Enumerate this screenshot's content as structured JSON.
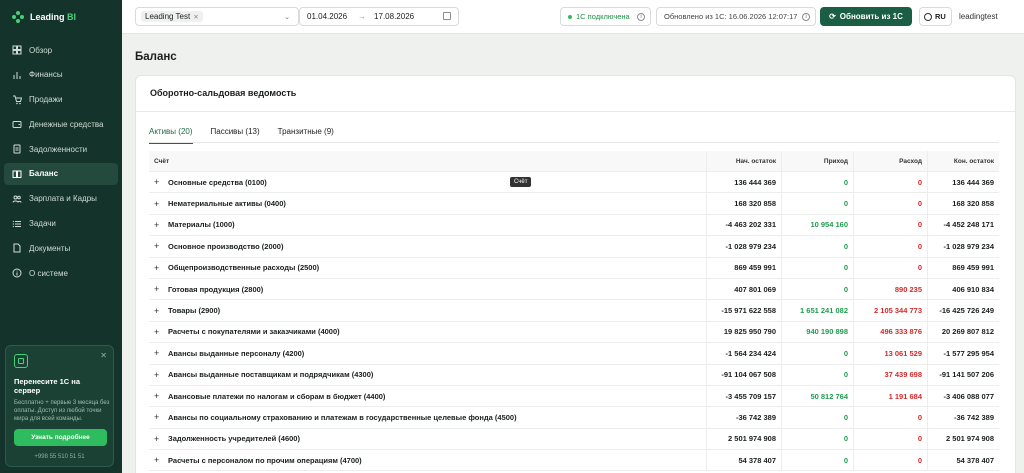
{
  "brand": {
    "name_part1": "Leading",
    "name_part2": "BI"
  },
  "sidebar": {
    "items": [
      {
        "label": "Обзор",
        "icon": "grid-icon",
        "active": false
      },
      {
        "label": "Финансы",
        "icon": "bar-chart-icon",
        "active": false
      },
      {
        "label": "Продажи",
        "icon": "cart-icon",
        "active": false
      },
      {
        "label": "Денежные средства",
        "icon": "wallet-icon",
        "active": false
      },
      {
        "label": "Задолженности",
        "icon": "document-icon",
        "active": false
      },
      {
        "label": "Баланс",
        "icon": "book-icon",
        "active": true
      },
      {
        "label": "Зарплата и Кадры",
        "icon": "users-icon",
        "active": false
      },
      {
        "label": "Задачи",
        "icon": "list-icon",
        "active": false
      },
      {
        "label": "Документы",
        "icon": "file-icon",
        "active": false
      },
      {
        "label": "О системе",
        "icon": "info-icon",
        "active": false
      }
    ],
    "promo": {
      "title": "Перенесите 1С на сервер",
      "text": "Бесплатно + первые 3 месяца без оплаты. Доступ из любой точки мира для всей команды.",
      "button": "Узнать подробнее",
      "phone": "+998 55 510 51 51"
    }
  },
  "topbar": {
    "company": "Leading Test",
    "date_from": "01.04.2026",
    "date_to": "17.08.2026",
    "connection_status": "1С подключена",
    "updated_text": "Обновлено из 1С: 16.06.2026 12:07:17",
    "refresh_button": "Обновить из 1С",
    "language": "RU",
    "user": "leadingtest"
  },
  "page": {
    "title": "Баланс",
    "card_title": "Оборотно-сальдовая ведомость",
    "tabs": [
      {
        "label": "Активы (20)",
        "active": true
      },
      {
        "label": "Пассивы (13)",
        "active": false
      },
      {
        "label": "Транзитные (9)",
        "active": false
      }
    ],
    "tooltip": "Счёт"
  },
  "table": {
    "columns": [
      "Счёт",
      "Нач. остаток",
      "Приход",
      "Расход",
      "Кон. остаток"
    ],
    "rows": [
      {
        "name": "Основные средства (0100)",
        "start": "136 444 369",
        "income": "0",
        "expense": "0",
        "end": "136 444 369"
      },
      {
        "name": "Нематериальные активы (0400)",
        "start": "168 320 858",
        "income": "0",
        "expense": "0",
        "end": "168 320 858"
      },
      {
        "name": "Материалы (1000)",
        "start": "-4 463 202 331",
        "income": "10 954 160",
        "expense": "0",
        "end": "-4 452 248 171"
      },
      {
        "name": "Основное производство (2000)",
        "start": "-1 028 979 234",
        "income": "0",
        "expense": "0",
        "end": "-1 028 979 234"
      },
      {
        "name": "Общепроизводственные расходы (2500)",
        "start": "869 459 991",
        "income": "0",
        "expense": "0",
        "end": "869 459 991"
      },
      {
        "name": "Готовая продукция (2800)",
        "start": "407 801 069",
        "income": "0",
        "expense": "890 235",
        "end": "406 910 834"
      },
      {
        "name": "Товары (2900)",
        "start": "-15 971 622 558",
        "income": "1 651 241 082",
        "expense": "2 105 344 773",
        "end": "-16 425 726 249"
      },
      {
        "name": "Расчеты с покупателями и заказчиками (4000)",
        "start": "19 825 950 790",
        "income": "940 190 898",
        "expense": "496 333 876",
        "end": "20 269 807 812"
      },
      {
        "name": "Авансы выданные персоналу (4200)",
        "start": "-1 564 234 424",
        "income": "0",
        "expense": "13 061 529",
        "end": "-1 577 295 954"
      },
      {
        "name": "Авансы выданные поставщикам и подрядчикам (4300)",
        "start": "-91 104 067 508",
        "income": "0",
        "expense": "37 439 698",
        "end": "-91 141 507 206"
      },
      {
        "name": "Авансовые платежи по налогам и сборам в бюджет (4400)",
        "start": "-3 455 709 157",
        "income": "50 812 764",
        "expense": "1 191 684",
        "end": "-3 406 088 077"
      },
      {
        "name": "Авансы по социальному страхованию и платежам в государственные целевые фонда (4500)",
        "start": "-36 742 389",
        "income": "0",
        "expense": "0",
        "end": "-36 742 389"
      },
      {
        "name": "Задолженность учредителей (4600)",
        "start": "2 501 974 908",
        "income": "0",
        "expense": "0",
        "end": "2 501 974 908"
      },
      {
        "name": "Расчеты с персоналом по прочим операциям (4700)",
        "start": "54 378 407",
        "income": "0",
        "expense": "0",
        "end": "54 378 407"
      }
    ]
  },
  "colors": {
    "sidebar_bg": "#14332a",
    "accent": "#1a5f43",
    "positive": "#1f9d4f",
    "negative": "#d42a2a"
  }
}
